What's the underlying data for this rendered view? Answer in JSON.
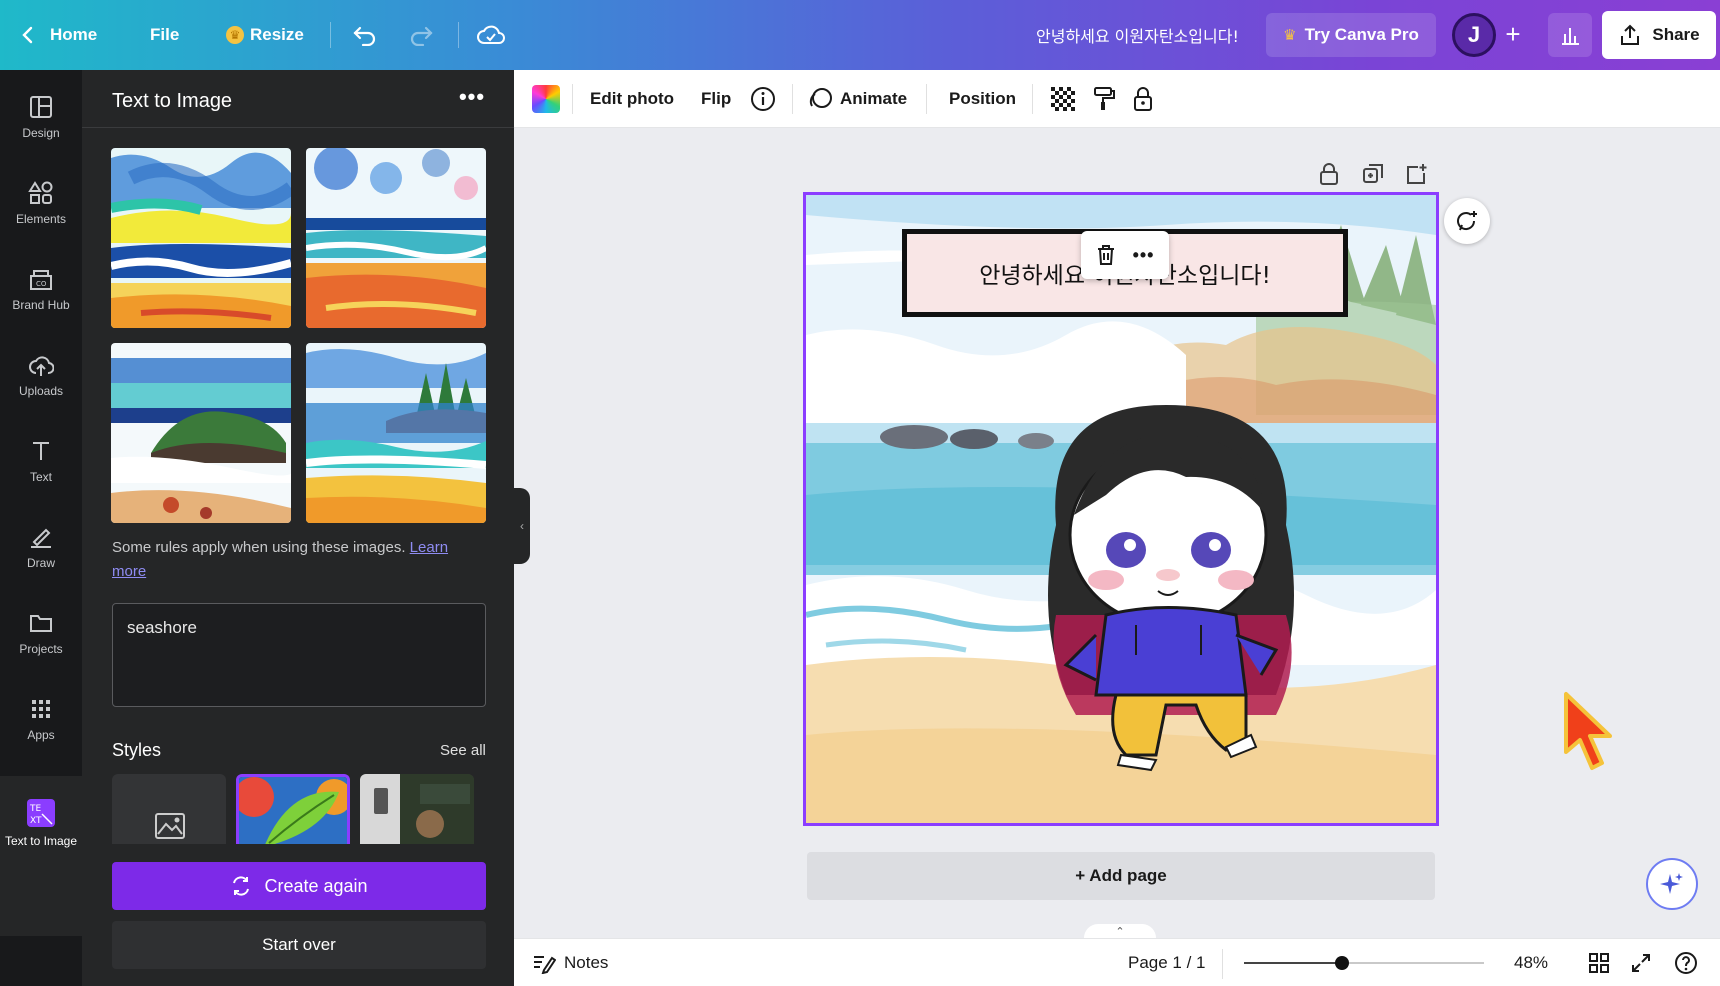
{
  "topbar": {
    "home_label": "Home",
    "file_label": "File",
    "resize_label": "Resize",
    "doc_title": "안녕하세요 이원자탄소입니다!",
    "try_pro_label": "Try Canva Pro",
    "avatar_initial": "J",
    "share_label": "Share"
  },
  "rail": {
    "items": [
      {
        "label": "Design",
        "icon": "layout-icon"
      },
      {
        "label": "Elements",
        "icon": "shapes-icon"
      },
      {
        "label": "Brand Hub",
        "icon": "brand-hub-icon"
      },
      {
        "label": "Uploads",
        "icon": "cloud-upload-icon"
      },
      {
        "label": "Text",
        "icon": "text-t-icon"
      },
      {
        "label": "Draw",
        "icon": "draw-pen-icon"
      },
      {
        "label": "Projects",
        "icon": "folder-icon"
      },
      {
        "label": "Apps",
        "icon": "grid-dots-icon"
      },
      {
        "label": "Text to Image",
        "icon": "text-to-image-icon"
      }
    ]
  },
  "panel": {
    "title": "Text to Image",
    "rules_text": "Some rules apply when using these images.",
    "learn_more": "Learn more",
    "prompt_value": "seashore",
    "styles_label": "Styles",
    "see_all": "See all",
    "create_again": "Create again",
    "start_over": "Start over"
  },
  "toolbar": {
    "edit_photo": "Edit photo",
    "flip": "Flip",
    "animate": "Animate",
    "position": "Position"
  },
  "canvas": {
    "text_content": "안녕하세요 이원자탄소입니다!",
    "add_page": "+ Add page"
  },
  "statusbar": {
    "notes": "Notes",
    "page_indicator": "Page 1 / 1",
    "zoom": "48%",
    "zoom_fraction": 0.41
  },
  "colors": {
    "accent": "#8b3dff",
    "create_button": "#7d2ae8",
    "panel_bg": "#252627",
    "rail_bg": "#18191b"
  }
}
